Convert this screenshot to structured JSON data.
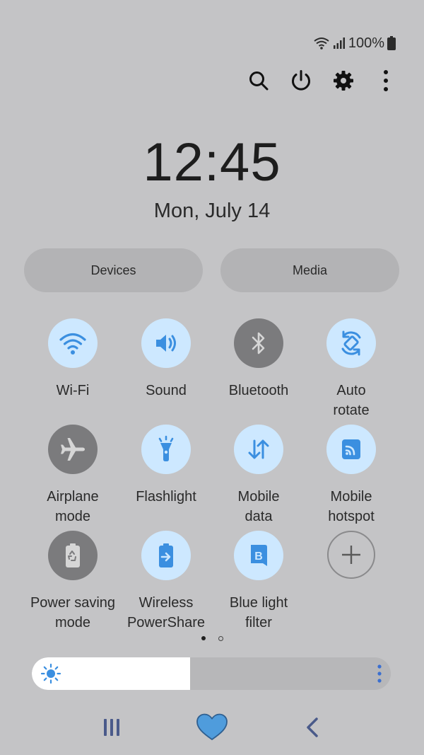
{
  "status_bar": {
    "battery": "100%"
  },
  "clock": {
    "time": "12:45",
    "date": "Mon, July 14"
  },
  "panels": {
    "devices_label": "Devices",
    "media_label": "Media"
  },
  "tiles": [
    {
      "label": "Wi-Fi",
      "icon": "wifi-icon",
      "state": "on"
    },
    {
      "label": "Sound",
      "icon": "speaker-icon",
      "state": "on"
    },
    {
      "label": "Bluetooth",
      "icon": "bluetooth-icon",
      "state": "off"
    },
    {
      "label": "Auto\nrotate",
      "icon": "auto-rotate-icon",
      "state": "on"
    },
    {
      "label": "Airplane\nmode",
      "icon": "airplane-icon",
      "state": "off"
    },
    {
      "label": "Flashlight",
      "icon": "flashlight-icon",
      "state": "on"
    },
    {
      "label": "Mobile\ndata",
      "icon": "mobile-data-icon",
      "state": "on"
    },
    {
      "label": "Mobile\nhotspot",
      "icon": "hotspot-icon",
      "state": "on"
    },
    {
      "label": "Power saving\nmode",
      "icon": "power-saving-icon",
      "state": "off"
    },
    {
      "label": "Wireless\nPowerShare",
      "icon": "wireless-powershare-icon",
      "state": "on"
    },
    {
      "label": "Blue light\nfilter",
      "icon": "blue-light-filter-icon",
      "state": "on"
    },
    {
      "label": "",
      "icon": "add-icon",
      "state": "add"
    }
  ],
  "pager": {
    "pages": 2,
    "active_index": 0
  },
  "brightness": {
    "level": 0.44
  },
  "colors": {
    "background": "#c4c4c6",
    "tile_on": "#cde8ff",
    "tile_off": "#7b7b7d",
    "accent": "#3b8fe0",
    "nav_icons": "#4a5a8a",
    "home_heart": "#4f9cdc"
  }
}
